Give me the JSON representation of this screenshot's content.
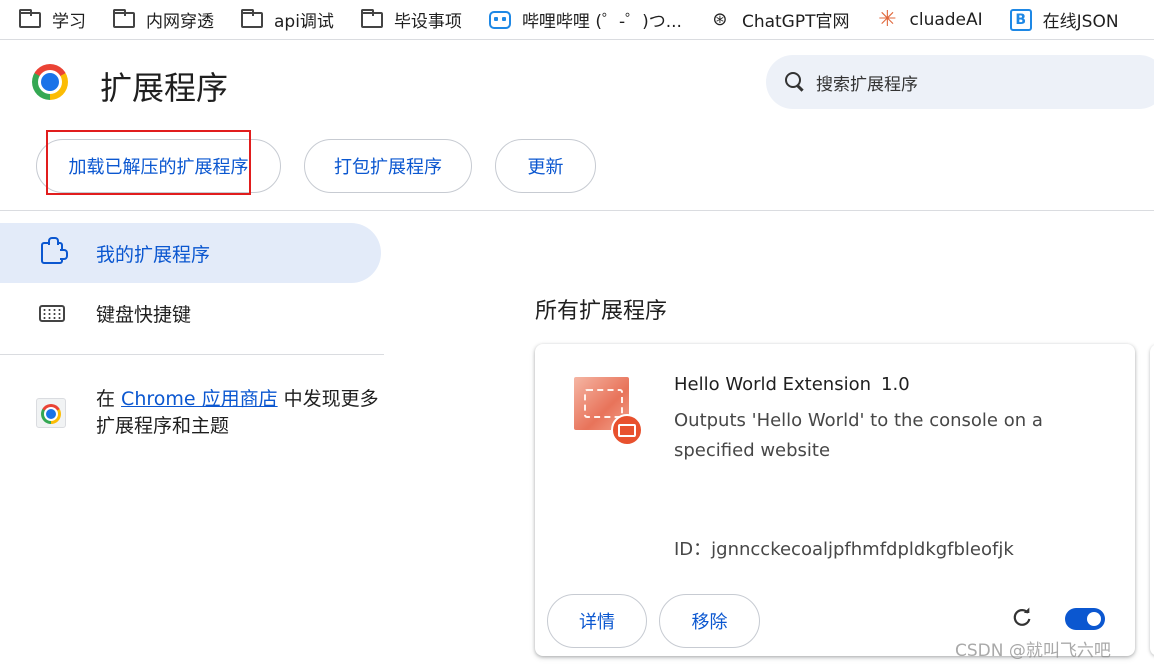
{
  "bookmarks": [
    {
      "label": "学习",
      "icon": "folder-icon"
    },
    {
      "label": "内网穿透",
      "icon": "folder-icon"
    },
    {
      "label": "api调试",
      "icon": "folder-icon"
    },
    {
      "label": "毕设事项",
      "icon": "folder-icon"
    },
    {
      "label": "哔哩哔哩 (゜-゜)つ...",
      "icon": "bilibili-icon"
    },
    {
      "label": "ChatGPT官网",
      "icon": "chatgpt-icon"
    },
    {
      "label": "cluadeAI",
      "icon": "claude-icon"
    },
    {
      "label": "在线JSON",
      "icon": "json-icon"
    }
  ],
  "header": {
    "title": "扩展程序",
    "search_placeholder": "搜索扩展程序"
  },
  "toolbar": {
    "load_unpacked": "加载已解压的扩展程序",
    "pack": "打包扩展程序",
    "update": "更新"
  },
  "sidebar": {
    "my_extensions": "我的扩展程序",
    "shortcuts": "键盘快捷键",
    "discover_prefix": "在 ",
    "discover_link": "Chrome 应用商店",
    "discover_suffix": " 中发现更多扩展程序和主题"
  },
  "main": {
    "section_title": "所有扩展程序",
    "extension": {
      "name": "Hello World Extension",
      "version": "1.0",
      "description": "Outputs 'Hello World' to the console on a specified website",
      "id": "ID：jgnncckecoaljpfhmfdpldkgfbleofjk",
      "details_label": "详情",
      "remove_label": "移除",
      "enabled": true
    }
  },
  "watermark": "CSDN @就叫飞六吧",
  "colors": {
    "accent": "#0b57d0",
    "highlight_box": "#e11d1d",
    "active_bg": "#e3ebf9"
  }
}
